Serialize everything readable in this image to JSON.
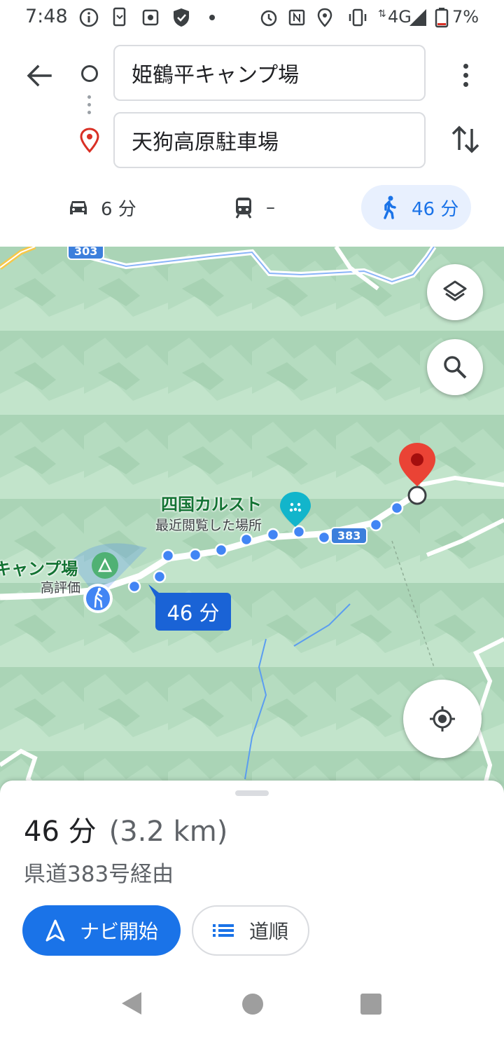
{
  "status_bar": {
    "time": "7:48",
    "network": "4G",
    "battery": "7%",
    "icons": [
      "info-icon",
      "phone-sync-icon",
      "settings-square-icon",
      "shield-icon",
      "dot-icon",
      "alarm-icon",
      "nfc-icon",
      "location-icon",
      "vibrate-icon",
      "signal-icon",
      "battery-icon"
    ]
  },
  "route": {
    "origin": "姫鶴平キャンプ場",
    "destination": "天狗高原駐車場"
  },
  "modes": {
    "car": "6 分",
    "transit": "–",
    "walk": "46 分",
    "selected": "walk"
  },
  "map": {
    "road_303": "303",
    "road_383": "383",
    "poi_karst": "四国カルスト",
    "poi_karst_sub": "最近閲覧した場所",
    "poi_camp": "キャンプ場",
    "poi_camp_sub": "高評価",
    "duration_bubble": "46 分"
  },
  "sheet": {
    "duration": "46 分",
    "distance": "(3.2 km)",
    "via": "県道383号経由",
    "start_label": "ナビ開始",
    "steps_label": "道順"
  },
  "colors": {
    "accent": "#1a73e8",
    "map_green": "#b9dfc3",
    "pin_red": "#ea4335"
  }
}
